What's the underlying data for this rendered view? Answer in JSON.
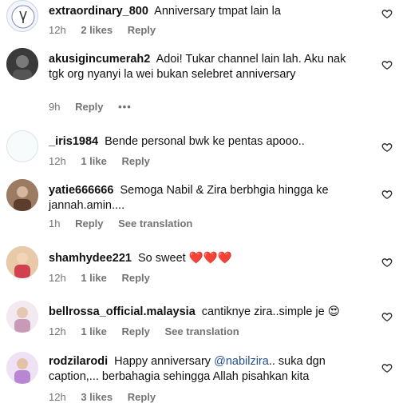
{
  "comments": [
    {
      "username": "extraordinary_800",
      "text": "Anniversary tmpat lain la",
      "time": "12h",
      "likes": "2 likes",
      "reply": "Reply"
    },
    {
      "username": "akusigincumerah2",
      "text": "Adoi! Tukar channel lain lah. Aku nak tgk org nyanyi la wei bukan selebret anniversary",
      "time": "9h",
      "reply": "Reply",
      "more": "•••"
    },
    {
      "username": "_iris1984",
      "text": "Bende personal bwk ke pentas apooo..",
      "time": "12h",
      "likes": "1 like",
      "reply": "Reply"
    },
    {
      "username": "yatie666666",
      "text": "Semoga Nabil & Zira berbhgia hingga ke jannah.amin....",
      "time": "1h",
      "reply": "Reply",
      "translate": "See translation"
    },
    {
      "username": "shamhydee221",
      "text": "So sweet",
      "emoji": "❤️❤️❤️",
      "time": "12h",
      "likes": "1 like",
      "reply": "Reply"
    },
    {
      "username": "bellrossa_official.malaysia",
      "text": "cantiknye zira..simple je",
      "emoji": "😍",
      "time": "12h",
      "likes": "1 like",
      "reply": "Reply",
      "translate": "See translation"
    },
    {
      "username": "rodzilarodi",
      "text_before": "Happy anniversary",
      "mention": "@nabilzira",
      "text_after": ".. suka dgn caption,... berbahagia sehingga Allah pisahkan kita",
      "time": "12h",
      "likes": "3 likes",
      "reply": "Reply"
    }
  ],
  "colors": {
    "meta": "#737373",
    "mention": "#264f8f",
    "heart_emoji": "#e0245e"
  },
  "icons": {
    "like": "heart-outline-icon",
    "more": "more-dots-icon"
  }
}
